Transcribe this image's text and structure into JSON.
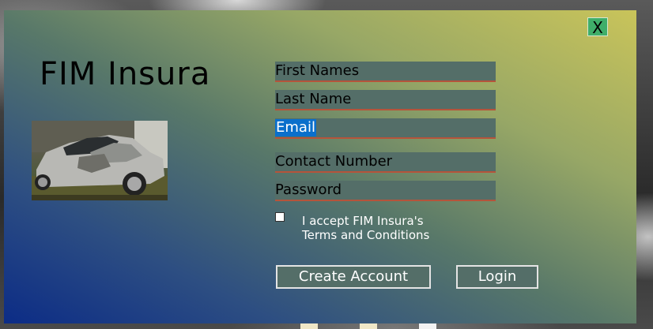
{
  "window": {
    "close_label": "X"
  },
  "brand": {
    "title": "FIM Insura"
  },
  "form": {
    "first_names": "First Names",
    "last_name": "Last Name",
    "email": "Email",
    "contact_number": "Contact Number",
    "password": "Password"
  },
  "terms": {
    "line1": "I accept FIM Insura's",
    "line2": "Terms and Conditions",
    "checked": false
  },
  "actions": {
    "create_account": "Create Account",
    "login": "Login"
  },
  "colors": {
    "gradient_start": "#0c2c86",
    "gradient_end": "#c9c45a",
    "field_bg": "#546e68",
    "field_underline": "#b5543b",
    "close_button": "#3fae6a",
    "selection": "#0a6fcb"
  },
  "icons": {
    "close": "close-icon",
    "car_photo": "damaged-car-image"
  }
}
